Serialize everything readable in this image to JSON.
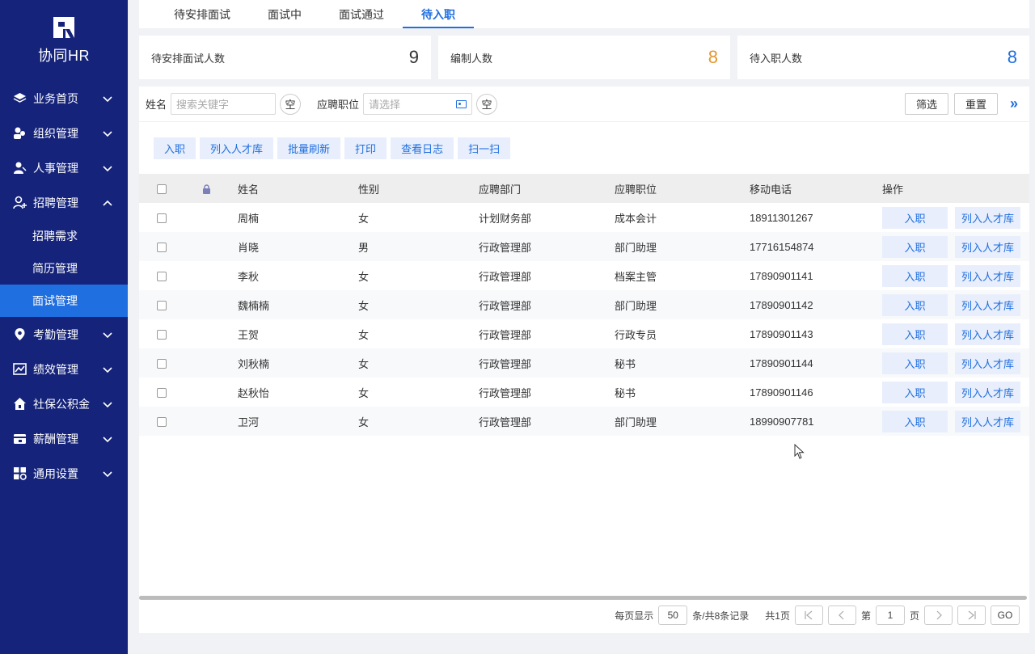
{
  "brand": {
    "name": "协同HR"
  },
  "sidebar": {
    "items": [
      {
        "label": "业务首页",
        "icon": "layers-icon",
        "expanded": false
      },
      {
        "label": "组织管理",
        "icon": "org-icon",
        "expanded": false
      },
      {
        "label": "人事管理",
        "icon": "person-icon",
        "expanded": false
      },
      {
        "label": "招聘管理",
        "icon": "person-add-icon",
        "expanded": true
      },
      {
        "label": "考勤管理",
        "icon": "location-icon",
        "expanded": false
      },
      {
        "label": "绩效管理",
        "icon": "chart-icon",
        "expanded": false
      },
      {
        "label": "社保公积金",
        "icon": "home-icon",
        "expanded": false
      },
      {
        "label": "薪酬管理",
        "icon": "wallet-icon",
        "expanded": false
      },
      {
        "label": "通用设置",
        "icon": "grid-settings-icon",
        "expanded": false
      }
    ],
    "recruit_sub": [
      {
        "label": "招聘需求"
      },
      {
        "label": "简历管理"
      },
      {
        "label": "面试管理"
      }
    ],
    "active_sub": "面试管理"
  },
  "tabs": [
    {
      "label": "待安排面试"
    },
    {
      "label": "面试中"
    },
    {
      "label": "面试通过"
    },
    {
      "label": "待入职"
    }
  ],
  "active_tab": "待入职",
  "stats": [
    {
      "name": "待安排面试人数",
      "value": "9",
      "color": "#333333"
    },
    {
      "name": "编制人数",
      "value": "8",
      "color": "#e6962e"
    },
    {
      "name": "待入职人数",
      "value": "8",
      "color": "#1f6fe0"
    }
  ],
  "filter": {
    "name_label": "姓名",
    "name_placeholder": "搜索关键字",
    "clear_label": "空",
    "position_label": "应聘职位",
    "position_placeholder": "请选择",
    "filter_btn": "筛选",
    "reset_btn": "重置"
  },
  "actions": [
    "入职",
    "列入人才库",
    "批量刷新",
    "打印",
    "查看日志",
    "扫一扫"
  ],
  "table": {
    "columns": [
      "姓名",
      "性别",
      "应聘部门",
      "应聘职位",
      "移动电话",
      "操作"
    ],
    "rows": [
      {
        "name": "周楠",
        "gender": "女",
        "dept": "计划财务部",
        "position": "成本会计",
        "phone": "18911301267"
      },
      {
        "name": "肖晓",
        "gender": "男",
        "dept": "行政管理部",
        "position": "部门助理",
        "phone": "17716154874"
      },
      {
        "name": "李秋",
        "gender": "女",
        "dept": "行政管理部",
        "position": "档案主管",
        "phone": "17890901141"
      },
      {
        "name": "魏楠楠",
        "gender": "女",
        "dept": "行政管理部",
        "position": "部门助理",
        "phone": "17890901142"
      },
      {
        "name": "王贺",
        "gender": "女",
        "dept": "行政管理部",
        "position": "行政专员",
        "phone": "17890901143"
      },
      {
        "name": "刘秋楠",
        "gender": "女",
        "dept": "行政管理部",
        "position": "秘书",
        "phone": "17890901144"
      },
      {
        "name": "赵秋怡",
        "gender": "女",
        "dept": "行政管理部",
        "position": "秘书",
        "phone": "17890901146"
      },
      {
        "name": "卫河",
        "gender": "女",
        "dept": "行政管理部",
        "position": "部门助理",
        "phone": "18990907781"
      }
    ],
    "row_actions": [
      "入职",
      "列入人才库"
    ]
  },
  "pager": {
    "per_page_label": "每页显示",
    "per_page": "50",
    "records_label": "条/共8条记录",
    "pages_label": "共1页",
    "page_prefix": "第",
    "page": "1",
    "page_suffix": "页",
    "go_label": "GO"
  }
}
